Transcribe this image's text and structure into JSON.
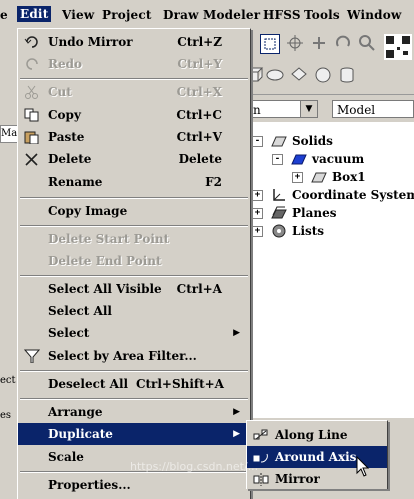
{
  "menubar": [
    "Edit",
    "View",
    "Project",
    "Draw",
    "Modeler",
    "HFSS",
    "Tools",
    "Window"
  ],
  "menubar_cut": "e",
  "combo": {
    "left_value": "n",
    "right_value": "Model"
  },
  "tree": [
    {
      "label": "Solids",
      "level": 0,
      "toggle": "-"
    },
    {
      "label": "vacuum",
      "level": 1,
      "toggle": "-"
    },
    {
      "label": "Box1",
      "level": 2,
      "toggle": "+"
    },
    {
      "label": "Coordinate Systems",
      "level": 0,
      "toggle": "+"
    },
    {
      "label": "Planes",
      "level": 0,
      "toggle": "+"
    },
    {
      "label": "Lists",
      "level": 0,
      "toggle": "+"
    }
  ],
  "left_labels": [
    "Ma",
    "ect",
    "es"
  ],
  "edit_menu": {
    "undo": {
      "label": "Undo Mirror",
      "shortcut": "Ctrl+Z"
    },
    "redo": {
      "label": "Redo",
      "shortcut": "Ctrl+Y"
    },
    "cut": {
      "label": "Cut",
      "shortcut": "Ctrl+X"
    },
    "copy": {
      "label": "Copy",
      "shortcut": "Ctrl+C"
    },
    "paste": {
      "label": "Paste",
      "shortcut": "Ctrl+V"
    },
    "delete": {
      "label": "Delete",
      "shortcut": "Delete"
    },
    "rename": {
      "label": "Rename",
      "shortcut": "F2"
    },
    "copy_image": {
      "label": "Copy Image"
    },
    "delete_start_point": {
      "label": "Delete Start Point"
    },
    "delete_end_point": {
      "label": "Delete End Point"
    },
    "select_all_visible": {
      "label": "Select All Visible",
      "shortcut": "Ctrl+A"
    },
    "select_all": {
      "label": "Select All"
    },
    "select": {
      "label": "Select"
    },
    "select_area_filter": {
      "label": "Select by Area Filter..."
    },
    "deselect_all": {
      "label": "Deselect All",
      "shortcut": "Ctrl+Shift+A"
    },
    "arrange": {
      "label": "Arrange"
    },
    "duplicate": {
      "label": "Duplicate"
    },
    "scale": {
      "label": "Scale"
    },
    "properties": {
      "label": "Properties..."
    }
  },
  "duplicate_submenu": {
    "along_line": "Along Line",
    "around_axis": "Around Axis",
    "mirror": "Mirror"
  },
  "watermark": "https://blog.csdn.net/...",
  "colors": {
    "menu_bg": "#d4d0c8",
    "highlight": "#0a246a",
    "disabled": "#9c9a94"
  }
}
